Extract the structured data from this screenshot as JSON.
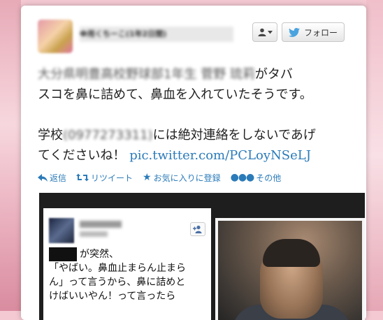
{
  "author": {
    "display_name": "Ф用くちーこ(1年2日間)",
    "avatar_icon": "user-avatar-blurred"
  },
  "buttons": {
    "user_menu_icon": "user-dropdown-icon",
    "follow_label": "フォロー"
  },
  "tweet": {
    "line1_blurred": "大分県明豊高校野球部1年生 菅野 琉莉",
    "line1_visible": "がタバ",
    "line2": "スコを鼻に詰めて、鼻血を入れていたそうです。",
    "line3_prefix": "学校",
    "line3_blurred": "(0977273311)",
    "line3_suffix": "には絶対連絡をしないであげ",
    "line4_prefix": "てくださいね！ ",
    "line4_link": "pic.twitter.com/PCLoyNSeLJ"
  },
  "actions": {
    "reply": "返信",
    "retweet": "リツイート",
    "favorite": "お気に入りに登録",
    "more": "その他"
  },
  "media": {
    "inner_text_line1": "が突然、",
    "inner_text_line2": "「やばい。鼻血止まらん止まら",
    "inner_text_line3": "ん」って言うから、鼻に詰めと",
    "inner_text_line4": "けばいいやん！って言ったら"
  },
  "colors": {
    "link": "#2b7bb9",
    "background": "#f4c9d2"
  }
}
